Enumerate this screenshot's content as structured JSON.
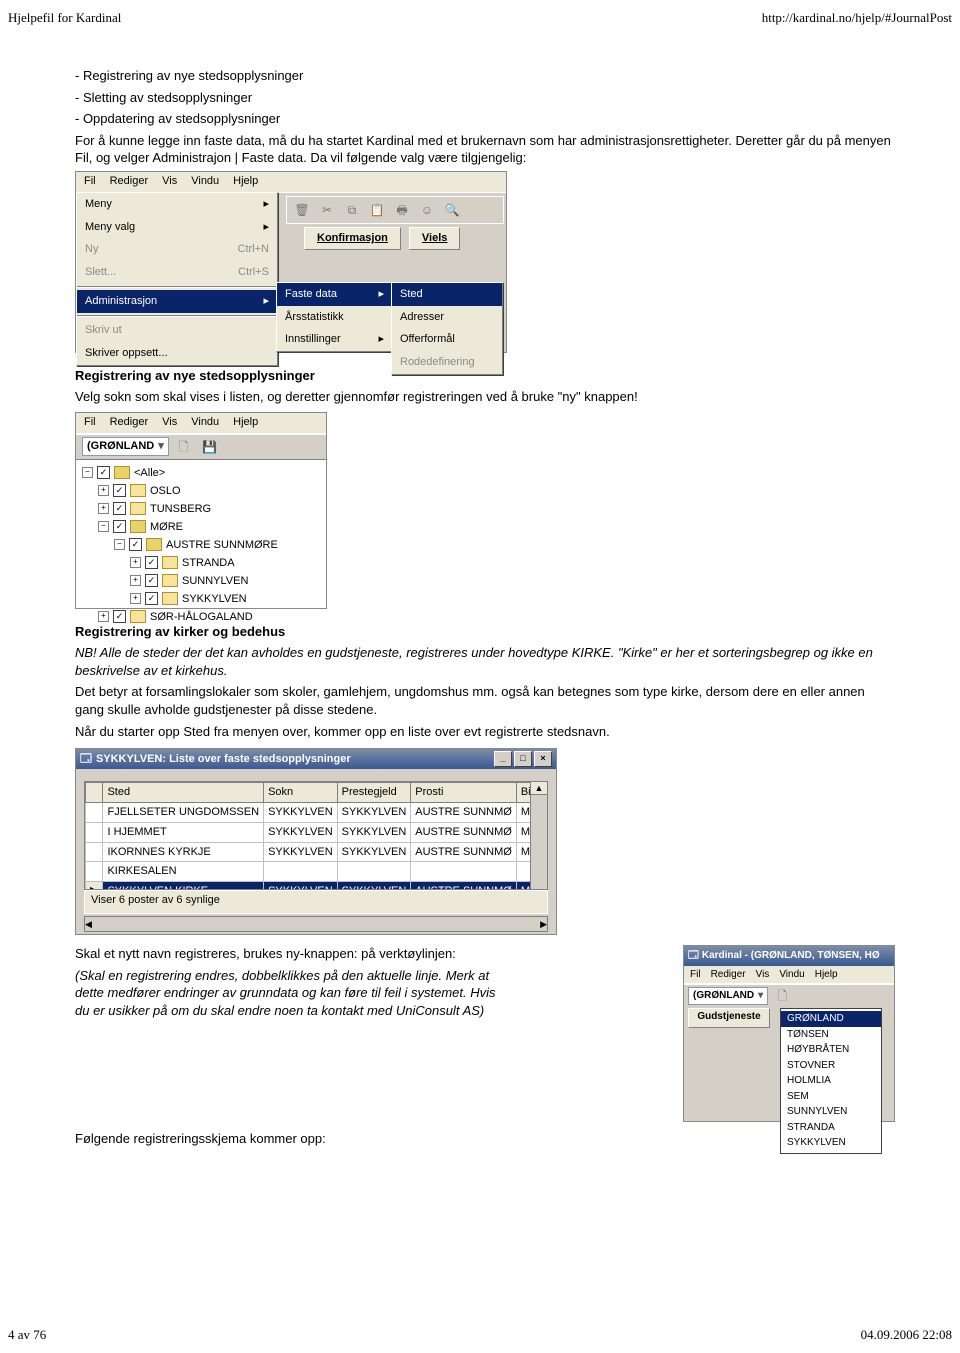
{
  "header": {
    "title": "Hjelpefil for Kardinal",
    "url": "http://kardinal.no/hjelp/#JournalPost"
  },
  "intro": {
    "bullets": [
      "- Registrering av nye stedsopplysninger",
      "- Sletting av stedsopplysninger",
      "- Oppdatering av stedsopplysninger"
    ],
    "para": "For å kunne legge inn faste data, må du ha startet Kardinal med et brukernavn som har administrasjonsrettigheter. Deretter går du på menyen Fil, og velger Administrajon | Faste data. Da vil følgende valg være tilgjengelig:"
  },
  "shot1": {
    "menubar": [
      "Fil",
      "Rediger",
      "Vis",
      "Vindu",
      "Hjelp"
    ],
    "tabs": [
      "Konfirmasjon",
      "Viels"
    ],
    "fil": [
      {
        "label": "Meny"
      },
      {
        "label": "Meny valg"
      },
      {
        "label": "Ny",
        "accel": "Ctrl+N"
      },
      {
        "label": "Slett...",
        "accel": "Ctrl+S"
      },
      {
        "label": "Administrasjon"
      },
      {
        "label": "Skriv ut"
      },
      {
        "label": "Skriver oppsett..."
      }
    ],
    "admin": [
      "Faste data",
      "Årsstatistikk",
      "Innstillinger"
    ],
    "faste": [
      "Sted",
      "Adresser",
      "Offerformål",
      "Rodedefinering"
    ]
  },
  "sec1": {
    "head": "Registrering av nye stedsopplysninger",
    "text": "Velg sokn som skal vises i listen, og deretter gjennomfør registreringen ved å bruke \"ny\" knappen!"
  },
  "shot2": {
    "combo": "(GRØNLAND",
    "tree": [
      "<Alle>",
      "OSLO",
      "TUNSBERG",
      "MØRE",
      "AUSTRE SUNNMØRE",
      "STRANDA",
      "SUNNYLVEN",
      "SYKKYLVEN",
      "SØR-HÅLOGALAND"
    ]
  },
  "sec2": {
    "head": "Registrering av kirker og bedehus",
    "note": "NB! Alle de steder der det kan avholdes en gudstjeneste, registreres under hovedtype KIRKE. \"Kirke\" er her et sorteringsbegrep og ikke en beskrivelse av et kirkehus.",
    "p1": "Det betyr at forsamlingslokaler som skoler, gamlehjem, ungdomshus mm. også kan betegnes som type kirke, dersom dere en eller annen gang skulle avholde gudstjenester på disse stedene.",
    "p2": "Når du starter opp Sted fra menyen over, kommer opp en liste over evt registrerte stedsnavn."
  },
  "shot3": {
    "title": "SYKKYLVEN: Liste over faste stedsopplysninger",
    "cols": [
      "Sted",
      "Sokn",
      "Prestegjeld",
      "Prosti",
      "Bispe"
    ],
    "rows": [
      [
        "FJELLSETER UNGDOMSSEN",
        "SYKKYLVEN",
        "SYKKYLVEN",
        "AUSTRE SUNNMØ",
        "MØR"
      ],
      [
        "I HJEMMET",
        "SYKKYLVEN",
        "SYKKYLVEN",
        "AUSTRE SUNNMØ",
        "MØR"
      ],
      [
        "IKORNNES KYRKJE",
        "SYKKYLVEN",
        "SYKKYLVEN",
        "AUSTRE SUNNMØ",
        "MØR"
      ],
      [
        "KIRKESALEN",
        "",
        "",
        "",
        ""
      ],
      [
        "SYKKYLVEN KIRKE",
        "SYKKYLVEN",
        "SYKKYLVEN",
        "AUSTRE SUNNMØ",
        "MØR"
      ]
    ],
    "status": "Viser 6 poster av 6 synlige"
  },
  "sec3": {
    "p1": "Skal et nytt navn registreres, brukes ny-knappen: på verktøylinjen:",
    "p2": "(Skal en registrering endres, dobbelklikkes på den aktuelle linje. Merk at dette medfører endringer av grunndata og kan føre til feil i systemet. Hvis du er usikker på om du skal endre noen ta kontakt med UniConsult AS)"
  },
  "shot4": {
    "title": "Kardinal - (GRØNLAND, TØNSEN, HØ",
    "combo": "(GRØNLAND",
    "button": "Gudstjeneste",
    "items": [
      "GRØNLAND",
      "TØNSEN",
      "HØYBRÅTEN",
      "STOVNER",
      "HOLMLIA",
      "SEM",
      "SUNNYLVEN",
      "STRANDA",
      "SYKKYLVEN"
    ]
  },
  "sec4": {
    "text": "Følgende registreringsskjema kommer opp:"
  },
  "footer": {
    "page": "4 av 76",
    "ts": "04.09.2006 22:08"
  }
}
